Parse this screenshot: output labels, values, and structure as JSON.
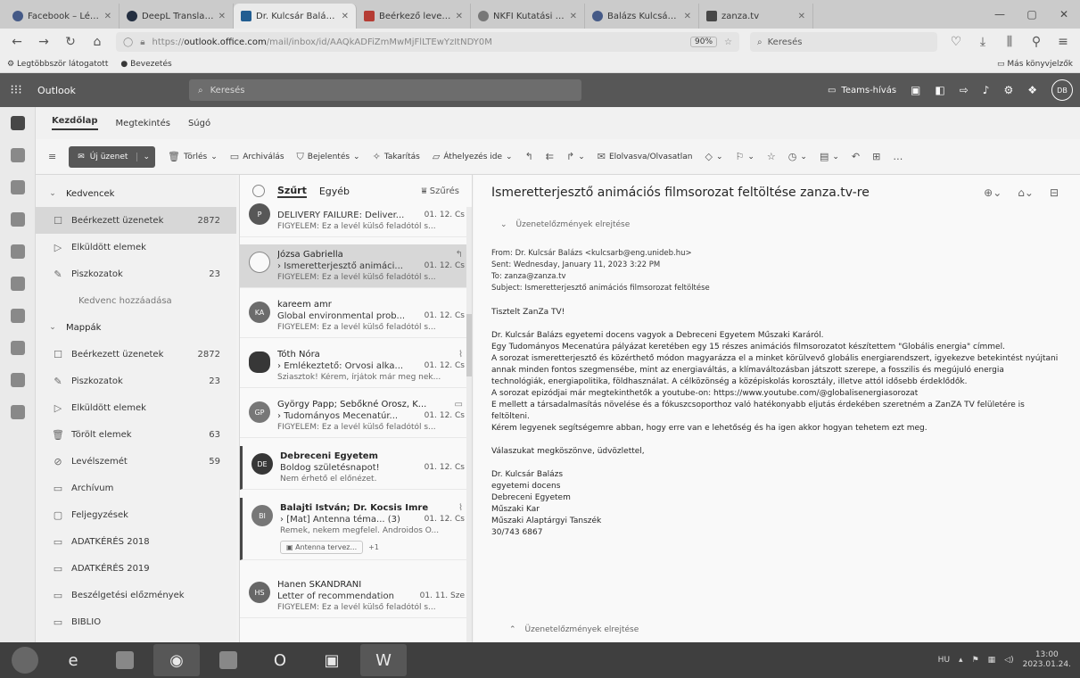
{
  "browser": {
    "tabs": [
      {
        "label": "Facebook – Lépj be",
        "active": false
      },
      {
        "label": "DeepL Translate: Th",
        "active": false
      },
      {
        "label": "Dr. Kulcsár Balázs Pr",
        "active": true
      },
      {
        "label": "Beérkező levelek (37",
        "active": false
      },
      {
        "label": "NKFI Kutatási Pályá",
        "active": false
      },
      {
        "label": "Balázs Kulcsár | Face",
        "active": false
      },
      {
        "label": "zanza.tv",
        "active": false
      }
    ],
    "url_prefix": "https://",
    "url_host": "outlook.office.com",
    "url_path": "/mail/inbox/id/AAQkADFiZmMwMjFlLTEwYzItNDY0M",
    "zoom": "90%",
    "search_placeholder": "Keresés",
    "bookmarks": [
      "Legtöbbször látogatott",
      "Bevezetés"
    ],
    "bookmarks_right": "Más könyvjelzők"
  },
  "outlook": {
    "app_name": "Outlook",
    "search_placeholder": "Keresés",
    "teams_label": "Teams-hívás",
    "avatar": "DB"
  },
  "ribbon": {
    "tabs": [
      "Kezdőlap",
      "Megtekintés",
      "Súgó"
    ],
    "new_label": "Új üzenet",
    "actions": [
      "Törlés",
      "Archiválás",
      "Bejelentés",
      "Takarítás",
      "Áthelyezés ide",
      "Elolvasva/Olvasatlan"
    ]
  },
  "folders": {
    "favorites_label": "Kedvencek",
    "favorites": [
      {
        "name": "Beérkezett üzenetek",
        "count": "2872",
        "selected": true
      },
      {
        "name": "Elküldött elemek",
        "count": ""
      },
      {
        "name": "Piszkozatok",
        "count": "23"
      }
    ],
    "add_favorite": "Kedvenc hozzáadása",
    "folders_label": "Mappák",
    "items": [
      {
        "name": "Beérkezett üzenetek",
        "count": "2872"
      },
      {
        "name": "Piszkozatok",
        "count": "23"
      },
      {
        "name": "Elküldött elemek",
        "count": ""
      },
      {
        "name": "Törölt elemek",
        "count": "63"
      },
      {
        "name": "Levélszemét",
        "count": "59"
      },
      {
        "name": "Archívum",
        "count": ""
      },
      {
        "name": "Feljegyzések",
        "count": ""
      },
      {
        "name": "ADATKÉRÉS 2018",
        "count": ""
      },
      {
        "name": "ADATKÉRÉS 2019",
        "count": ""
      },
      {
        "name": "Beszélgetési előzmények",
        "count": ""
      },
      {
        "name": "BIBLIO",
        "count": ""
      }
    ]
  },
  "list": {
    "filter_focused": "Szűrt",
    "filter_other": "Egyéb",
    "filter_label": "Szűrés",
    "messages": [
      {
        "avatar": "P",
        "color": "#555",
        "sender": "DELIVERY FAILURE: Deliver...",
        "subject": "",
        "date": "01. 12. Cs",
        "preview": "FIGYELEM: Ez a levél külső feladótól s..."
      },
      {
        "avatar": "",
        "color": "#fff",
        "sender": "Józsa Gabriella",
        "subject": "Ismeretterjesztő animáci...",
        "date": "01. 12. Cs",
        "preview": "FIGYELEM: Ez a levél külső feladótól s..."
      },
      {
        "avatar": "KA",
        "color": "#6b6b6b",
        "sender": "kareem amr",
        "subject": "Global environmental prob...",
        "date": "01. 12. Cs",
        "preview": "FIGYELEM: Ez a levél külső feladótól s..."
      },
      {
        "avatar": "",
        "color": "#333",
        "sender": "Tóth Nóra",
        "subject": "Emlékeztető: Orvosi alka...",
        "date": "01. 12. Cs",
        "preview": "Sziasztok! Kérem, írjátok már meg nek..."
      },
      {
        "avatar": "GP",
        "color": "#777",
        "sender": "György Papp; Sebőkné Orosz, K...",
        "subject": "Tudományos Mecenatúr...",
        "date": "01. 12. Cs",
        "preview": "FIGYELEM: Ez a levél külső feladótól s..."
      },
      {
        "avatar": "DE",
        "color": "#333",
        "sender": "Debreceni Egyetem",
        "subject": "Boldog születésnapot!",
        "date": "01. 12. Cs",
        "preview": "Nem érhető el előnézet."
      },
      {
        "avatar": "BI",
        "color": "#777",
        "sender": "Balajti István; Dr. Kocsis Imre",
        "subject": "[Mat] Antenna téma... (3)",
        "date": "01. 12. Cs",
        "preview": "Remek, nekem megfelel. Androidos O...",
        "attachment": "Antenna tervez...",
        "more": "+1"
      },
      {
        "avatar": "HS",
        "color": "#666",
        "sender": "Hanen SKANDRANI",
        "subject": "Letter of recommendation",
        "date": "01. 11. Sze",
        "preview": "FIGYELEM: Ez a levél külső feladótól s..."
      }
    ]
  },
  "reading": {
    "title": "Ismeretterjesztő animációs filmsorozat feltöltése zanza.tv-re",
    "show_history": "Üzenetelőzmények elrejtése",
    "from": "From: Dr. Kulcsár Balázs <kulcsarb@eng.unideb.hu>",
    "sent": "Sent: Wednesday, January 11, 2023 3:22 PM",
    "to": "To: zanza@zanza.tv",
    "subject": "Subject: Ismeretterjesztő animációs filmsorozat feltöltése",
    "greeting": "Tisztelt ZanZa TV!",
    "paragraphs": [
      "Dr. Kulcsár Balázs egyetemi docens vagyok a Debreceni Egyetem Műszaki Karáról.",
      "Egy Tudományos Mecenatúra pályázat keretében egy 15 részes animációs filmsorozatot készítettem \"Globális energia\" címmel.",
      "A sorozat ismeretterjesztő és közérthető módon magyarázza el a minket körülvevő globális energiarendszert, igyekezve betekintést nyújtani annak minden fontos szegmensébe, mint az energiaváltás, a klímaváltozásban játszott szerepe, a fosszilis és megújuló energia technológiák, energiapolitika, földhasználat. A célközönség a középiskolás korosztály, illetve attól idősebb érdeklődők.",
      "A sorozat epizódjai már megtekinthetők a youtube-on: https://www.youtube.com/@globalisenergiasorozat",
      "E mellett a társadalmasítás növelése és a fókuszcsoporthoz való hatékonyabb eljutás érdekében szeretném a ZanZA TV felületére is feltölteni.",
      "Kérem legyenek segítségemre abban, hogy erre van e lehetőség és ha igen akkor hogyan tehetem ezt meg."
    ],
    "closing": "Válaszukat megköszönve, üdvözlettel,",
    "signature": [
      "Dr. Kulcsár Balázs",
      "egyetemi docens",
      "Debreceni Egyetem",
      "Műszaki Kar",
      "Műszaki Alaptárgyi Tanszék",
      "30/743 6867"
    ],
    "hide_history": "Üzenetelőzmények elrejtése"
  },
  "taskbar": {
    "lang": "HU",
    "time": "13:00",
    "date": "2023.01.24."
  }
}
